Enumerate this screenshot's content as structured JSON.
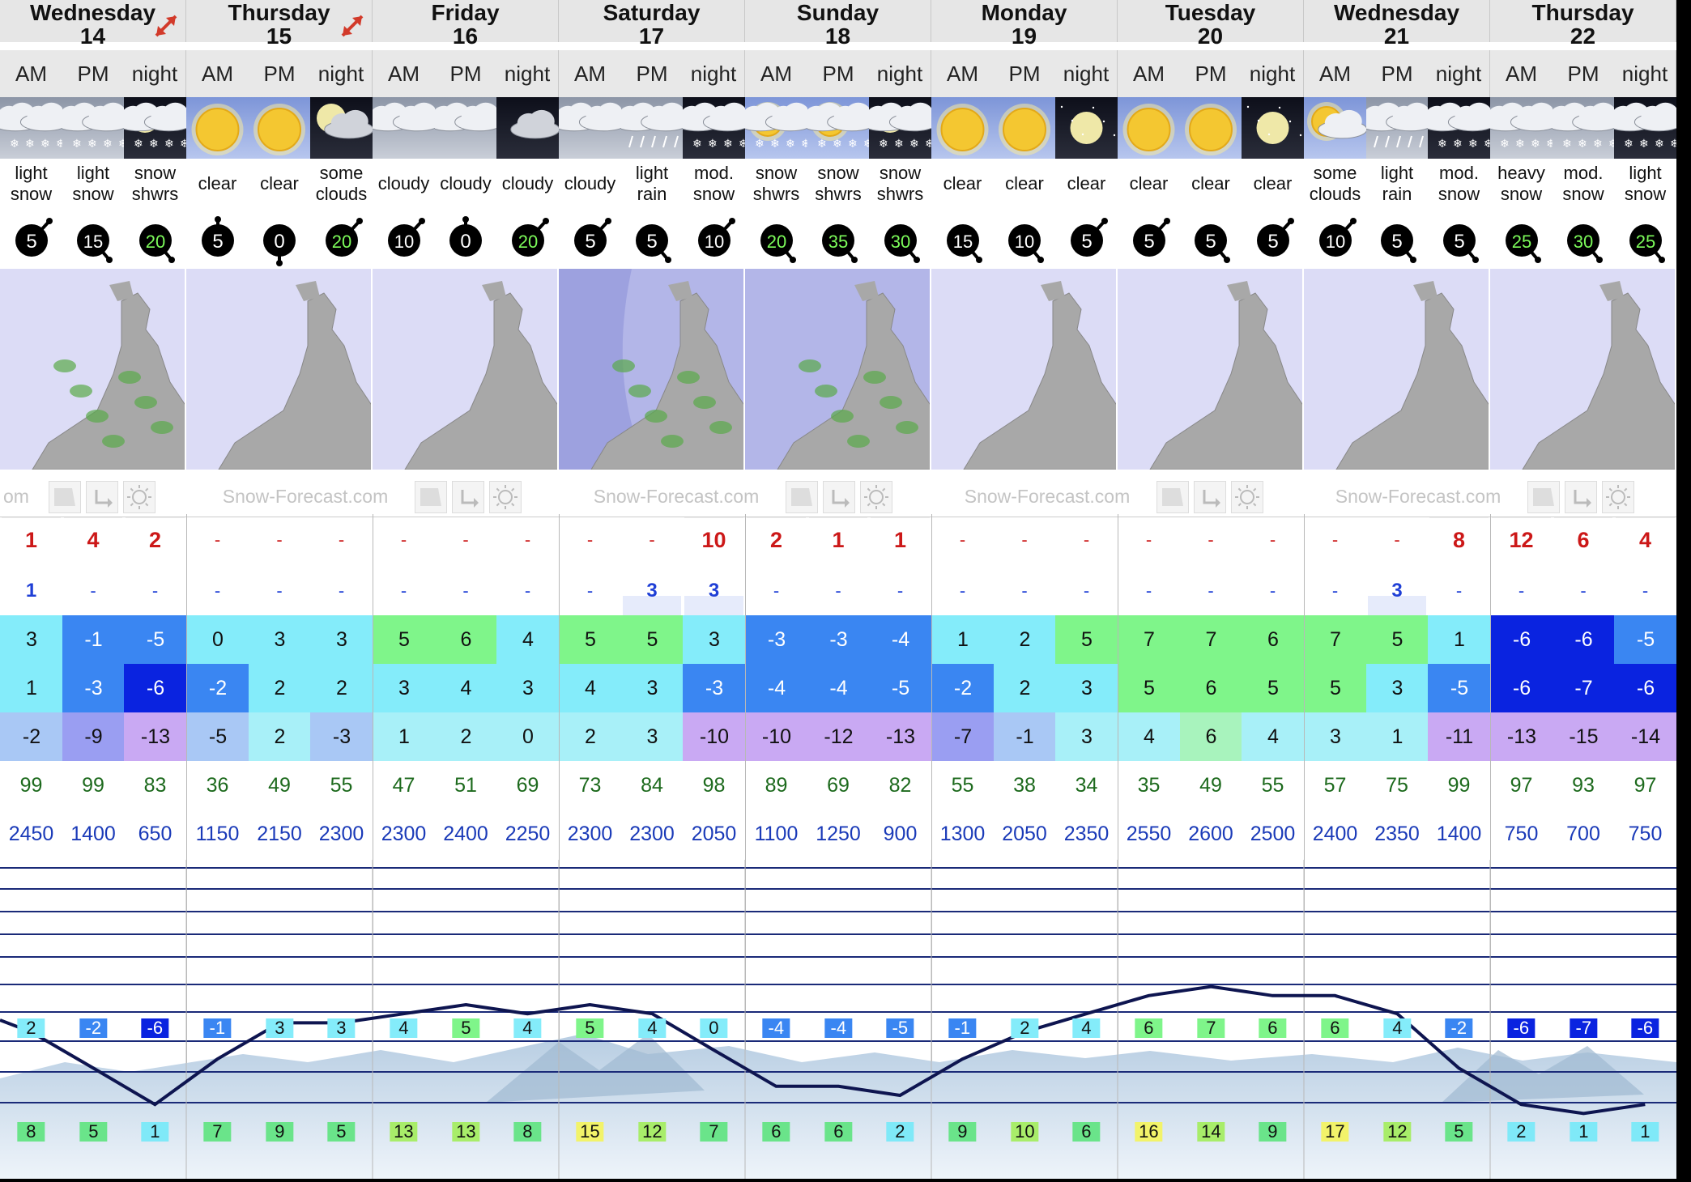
{
  "days": [
    {
      "name": "Wednesday",
      "date": "14",
      "expand": true
    },
    {
      "name": "Thursday",
      "date": "15",
      "expand": true
    },
    {
      "name": "Friday",
      "date": "16",
      "expand": false
    },
    {
      "name": "Saturday",
      "date": "17",
      "expand": false
    },
    {
      "name": "Sunday",
      "date": "18",
      "expand": false
    },
    {
      "name": "Monday",
      "date": "19",
      "expand": false
    },
    {
      "name": "Tuesday",
      "date": "20",
      "expand": false
    },
    {
      "name": "Wednesday",
      "date": "21",
      "expand": false
    },
    {
      "name": "Thursday",
      "date": "22",
      "expand": false
    }
  ],
  "periods": [
    "AM",
    "PM",
    "night"
  ],
  "logo_text": "Snow-Forecast.com",
  "logo_first_partial": "om",
  "weather": [
    {
      "text": [
        "light",
        "snow"
      ],
      "icon": "cloud-snow-icon"
    },
    {
      "text": [
        "light",
        "snow"
      ],
      "icon": "cloud-snow-icon"
    },
    {
      "text": [
        "snow",
        "shwrs"
      ],
      "icon": "moon-cloud-snow-icon"
    },
    {
      "text": [
        "clear"
      ],
      "icon": "sun-icon"
    },
    {
      "text": [
        "clear"
      ],
      "icon": "sun-icon"
    },
    {
      "text": [
        "some",
        "clouds"
      ],
      "icon": "moon-cloud-icon"
    },
    {
      "text": [
        "cloudy"
      ],
      "icon": "cloud-icon"
    },
    {
      "text": [
        "cloudy"
      ],
      "icon": "cloud-icon"
    },
    {
      "text": [
        "cloudy"
      ],
      "icon": "night-cloud-icon"
    },
    {
      "text": [
        "cloudy"
      ],
      "icon": "cloud-icon"
    },
    {
      "text": [
        "light",
        "rain"
      ],
      "icon": "cloud-rain-icon"
    },
    {
      "text": [
        "mod.",
        "snow"
      ],
      "icon": "night-cloud-snow-icon"
    },
    {
      "text": [
        "snow",
        "shwrs"
      ],
      "icon": "sun-cloud-snow-icon"
    },
    {
      "text": [
        "snow",
        "shwrs"
      ],
      "icon": "sun-cloud-snow-icon"
    },
    {
      "text": [
        "snow",
        "shwrs"
      ],
      "icon": "moon-cloud-snow-icon"
    },
    {
      "text": [
        "clear"
      ],
      "icon": "sun-icon"
    },
    {
      "text": [
        "clear"
      ],
      "icon": "sun-icon"
    },
    {
      "text": [
        "clear"
      ],
      "icon": "moon-icon"
    },
    {
      "text": [
        "clear"
      ],
      "icon": "sun-icon"
    },
    {
      "text": [
        "clear"
      ],
      "icon": "sun-icon"
    },
    {
      "text": [
        "clear"
      ],
      "icon": "moon-icon"
    },
    {
      "text": [
        "some",
        "clouds"
      ],
      "icon": "sun-cloud-icon"
    },
    {
      "text": [
        "light",
        "rain"
      ],
      "icon": "cloud-rain-icon"
    },
    {
      "text": [
        "mod.",
        "snow"
      ],
      "icon": "night-cloud-snow-icon"
    },
    {
      "text": [
        "heavy",
        "snow"
      ],
      "icon": "cloud-snow-icon"
    },
    {
      "text": [
        "mod.",
        "snow"
      ],
      "icon": "cloud-snow-icon"
    },
    {
      "text": [
        "light",
        "snow"
      ],
      "icon": "night-cloud-snow-icon"
    }
  ],
  "wind": [
    {
      "speed": "5",
      "dir": "sw"
    },
    {
      "speed": "15",
      "dir": "nw"
    },
    {
      "speed": "20",
      "dir": "nw",
      "strong": true
    },
    {
      "speed": "5",
      "dir": "ne"
    },
    {
      "speed": "0",
      "dir": "se"
    },
    {
      "speed": "20",
      "dir": "sw",
      "strong": true
    },
    {
      "speed": "10",
      "dir": "sw"
    },
    {
      "speed": "0",
      "dir": "ne"
    },
    {
      "speed": "20",
      "dir": "sw",
      "strong": true
    },
    {
      "speed": "5",
      "dir": "sw"
    },
    {
      "speed": "5",
      "dir": "nw"
    },
    {
      "speed": "10",
      "dir": "sw"
    },
    {
      "speed": "20",
      "dir": "nw",
      "strong": true
    },
    {
      "speed": "35",
      "dir": "nw",
      "strong": true
    },
    {
      "speed": "30",
      "dir": "nw",
      "strong": true
    },
    {
      "speed": "15",
      "dir": "nw"
    },
    {
      "speed": "10",
      "dir": "nw"
    },
    {
      "speed": "5",
      "dir": "sw"
    },
    {
      "speed": "5",
      "dir": "sw"
    },
    {
      "speed": "5",
      "dir": "nw"
    },
    {
      "speed": "5",
      "dir": "sw"
    },
    {
      "speed": "10",
      "dir": "sw"
    },
    {
      "speed": "5",
      "dir": "nw"
    },
    {
      "speed": "5",
      "dir": "nw"
    },
    {
      "speed": "25",
      "dir": "nw",
      "strong": true
    },
    {
      "speed": "30",
      "dir": "nw",
      "strong": true
    },
    {
      "speed": "25",
      "dir": "nw",
      "strong": true
    }
  ],
  "snow_cm": [
    "1",
    "4",
    "2",
    "-",
    "-",
    "-",
    "-",
    "-",
    "-",
    "-",
    "-",
    "10",
    "2",
    "1",
    "1",
    "-",
    "-",
    "-",
    "-",
    "-",
    "-",
    "-",
    "-",
    "8",
    "12",
    "6",
    "4"
  ],
  "rain_mm": [
    "1",
    "-",
    "-",
    "-",
    "-",
    "-",
    "-",
    "-",
    "-",
    "-",
    "3",
    "3",
    "-",
    "-",
    "-",
    "-",
    "-",
    "-",
    "-",
    "-",
    "-",
    "-",
    "3",
    "-",
    "-",
    "-",
    "-"
  ],
  "temp_max": [
    3,
    -1,
    -5,
    0,
    3,
    3,
    5,
    6,
    4,
    5,
    5,
    3,
    -3,
    -3,
    -4,
    1,
    2,
    5,
    7,
    7,
    6,
    7,
    5,
    1,
    -6,
    -6,
    -5
  ],
  "temp_min": [
    1,
    -3,
    -6,
    -2,
    2,
    2,
    3,
    4,
    3,
    4,
    3,
    -3,
    -4,
    -4,
    -5,
    -2,
    2,
    3,
    5,
    6,
    5,
    5,
    3,
    -5,
    -6,
    -7,
    -6
  ],
  "wind_chill": [
    -2,
    -9,
    -13,
    -5,
    2,
    -3,
    1,
    2,
    0,
    2,
    3,
    -10,
    -10,
    -12,
    -13,
    -7,
    -1,
    3,
    4,
    6,
    4,
    3,
    1,
    -11,
    -13,
    -15,
    -14
  ],
  "humidity": [
    99,
    99,
    83,
    36,
    49,
    55,
    47,
    51,
    69,
    73,
    84,
    98,
    89,
    69,
    82,
    55,
    38,
    34,
    35,
    49,
    55,
    57,
    75,
    99,
    97,
    93,
    97
  ],
  "freezing_level": [
    2450,
    1400,
    650,
    1150,
    2150,
    2300,
    2300,
    2400,
    2250,
    2300,
    2300,
    2050,
    1100,
    1250,
    900,
    1300,
    2050,
    2350,
    2550,
    2600,
    2500,
    2400,
    2350,
    1400,
    750,
    700,
    750
  ],
  "chart_data": {
    "type": "line",
    "title": "",
    "series": [
      {
        "values": [
          2,
          -2,
          -6,
          -1,
          3,
          3,
          4,
          5,
          4,
          5,
          4,
          0,
          -4,
          -4,
          -5,
          -1,
          2,
          4,
          6,
          7,
          6,
          6,
          4,
          -2,
          -6,
          -7,
          -6
        ]
      },
      {
        "values": [
          8,
          5,
          1,
          7,
          9,
          5,
          13,
          13,
          8,
          15,
          12,
          7,
          6,
          6,
          2,
          9,
          10,
          6,
          16,
          14,
          9,
          17,
          12,
          5,
          2,
          1,
          1
        ]
      }
    ]
  }
}
